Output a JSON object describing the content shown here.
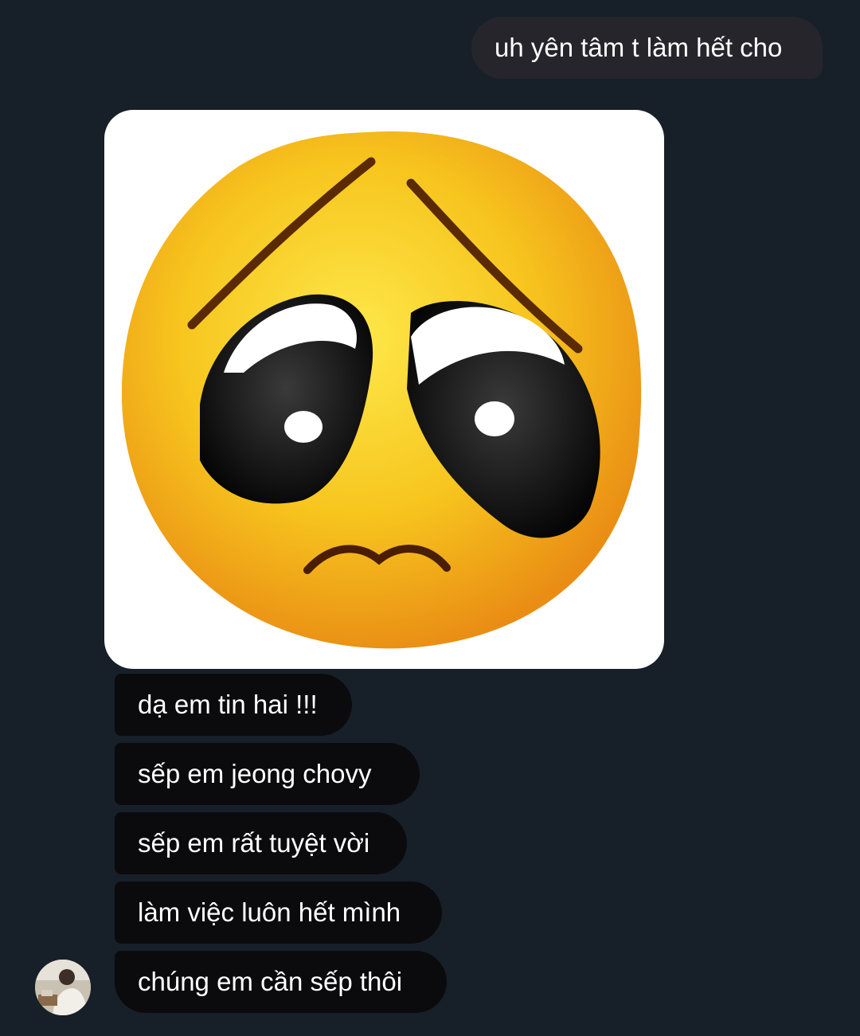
{
  "messages": {
    "outgoing": [
      {
        "text": "uh yên tâm t làm hết cho"
      }
    ],
    "incoming_image": {
      "icon": "pleading-face-emoji",
      "colors": {
        "face": "#f7c51e",
        "face_edge": "#e98d14",
        "background": "#ffffff"
      }
    },
    "incoming": [
      {
        "text": "dạ em tin hai !!!"
      },
      {
        "text": "sếp em jeong chovy"
      },
      {
        "text": "sếp em rất tuyệt vời"
      },
      {
        "text": "làm việc luôn hết mình"
      },
      {
        "text": "chúng em cần sếp thôi"
      }
    ]
  },
  "sender": {
    "avatar_icon": "user-avatar-photo"
  },
  "theme": {
    "background": "#172029",
    "outgoing_bubble": "#26252c",
    "incoming_bubble": "#0b0b0d",
    "text": "#ffffff"
  }
}
